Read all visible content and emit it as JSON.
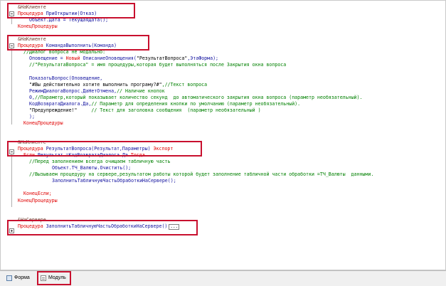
{
  "editor": {
    "lines": [
      {
        "indent": 2,
        "parts": [
          {
            "t": "&НаКлиенте",
            "c": "pp"
          }
        ]
      },
      {
        "indent": 2,
        "parts": [
          {
            "t": "Процедура ",
            "c": "kw"
          },
          {
            "t": "ПриОткрытии(Отказ)",
            "c": "id"
          }
        ]
      },
      {
        "indent": 6,
        "parts": [
          {
            "t": "Объект.Дата = ТекущаяДата();",
            "c": "id"
          }
        ]
      },
      {
        "indent": 2,
        "parts": [
          {
            "t": "КонецПроцедуры",
            "c": "kw"
          }
        ]
      },
      {
        "indent": 2,
        "parts": [
          {
            "t": "",
            "c": "str"
          }
        ]
      },
      {
        "indent": 2,
        "parts": [
          {
            "t": "&НаКлиенте",
            "c": "pp"
          }
        ]
      },
      {
        "indent": 2,
        "parts": [
          {
            "t": "Процедура ",
            "c": "kw"
          },
          {
            "t": "КомандаВыполнить(Команда)",
            "c": "id"
          }
        ]
      },
      {
        "indent": 4,
        "parts": [
          {
            "t": "//Диалог вопроса не модально:",
            "c": "cm"
          }
        ]
      },
      {
        "indent": 6,
        "parts": [
          {
            "t": "Оповещение = ",
            "c": "id"
          },
          {
            "t": "Новый ",
            "c": "kw"
          },
          {
            "t": "ОписаниеОповещения(",
            "c": "id"
          },
          {
            "t": "\"РезультатВопроса\"",
            "c": "str"
          },
          {
            "t": ",ЭтаФорма);",
            "c": "id"
          }
        ]
      },
      {
        "indent": 6,
        "parts": [
          {
            "t": "//\"РезультатаВопроса\" = имя процедуры,которая будет выполняться после Закрытия окна вопроса",
            "c": "cm"
          }
        ]
      },
      {
        "indent": 2,
        "parts": [
          {
            "t": "",
            "c": "str"
          }
        ]
      },
      {
        "indent": 6,
        "parts": [
          {
            "t": "ПоказатьВопрос(Оповещение,",
            "c": "id"
          }
        ]
      },
      {
        "indent": 6,
        "parts": [
          {
            "t": "\"#Вы действительно хотите выполнить програму?#\"",
            "c": "str"
          },
          {
            "t": ",//Текст вопроса",
            "c": "cm"
          }
        ]
      },
      {
        "indent": 6,
        "parts": [
          {
            "t": "РежимДиалогаВопрос.ДаНетОтмена,",
            "c": "id"
          },
          {
            "t": "// Наличие кнопок",
            "c": "cm"
          }
        ]
      },
      {
        "indent": 6,
        "parts": [
          {
            "t": "0,",
            "c": "id"
          },
          {
            "t": "//Параметр,который показывает количество секунд  до автоматического закрытия окна вопроса (параметр необязательный).",
            "c": "cm"
          }
        ]
      },
      {
        "indent": 6,
        "parts": [
          {
            "t": "КодВозвратаДиалога.Да,",
            "c": "id"
          },
          {
            "t": "// Параметр для определения кнопки по умолчанию (параметр необязательный).",
            "c": "cm"
          }
        ]
      },
      {
        "indent": 6,
        "parts": [
          {
            "t": "\"Предупреждение!\"",
            "c": "str"
          },
          {
            "t": "     ",
            "c": "str"
          },
          {
            "t": "// Текст для заголовка сообщения  (параметр необязательный )",
            "c": "cm"
          }
        ]
      },
      {
        "indent": 6,
        "parts": [
          {
            "t": ");",
            "c": "id"
          }
        ]
      },
      {
        "indent": 4,
        "parts": [
          {
            "t": "КонецПроцедуры",
            "c": "kw"
          }
        ]
      },
      {
        "indent": 2,
        "parts": [
          {
            "t": "",
            "c": "str"
          }
        ]
      },
      {
        "indent": 2,
        "parts": [
          {
            "t": "",
            "c": "str"
          }
        ]
      },
      {
        "indent": 2,
        "parts": [
          {
            "t": "&НаКлиенте",
            "c": "pp"
          }
        ]
      },
      {
        "indent": 2,
        "parts": [
          {
            "t": "Процедура ",
            "c": "kw"
          },
          {
            "t": "РезультатВопроса(Результат,Параметры) ",
            "c": "id"
          },
          {
            "t": "Экспорт",
            "c": "kw"
          }
        ]
      },
      {
        "indent": 4,
        "parts": [
          {
            "t": "Если ",
            "c": "kw"
          },
          {
            "t": "Результат =КодВозвратаДиалога.Да ",
            "c": "id"
          },
          {
            "t": "Тогда",
            "c": "kw"
          }
        ]
      },
      {
        "indent": 6,
        "parts": [
          {
            "t": "//Перед заполнением всегда очищаем табличную часть",
            "c": "cm"
          }
        ]
      },
      {
        "indent": 14,
        "parts": [
          {
            "t": "Объект.ТЧ_Валюты.Очистить();",
            "c": "id"
          }
        ]
      },
      {
        "indent": 6,
        "parts": [
          {
            "t": "//Вызываем процедуру на сервере,результатом работы которой будет заполнение табличной части обработки =ТЧ_Валюты  данными.",
            "c": "cm"
          }
        ]
      },
      {
        "indent": 14,
        "parts": [
          {
            "t": "ЗаполнитьТабличнуюЧастьОбработкиНаСервере();",
            "c": "id"
          }
        ]
      },
      {
        "indent": 2,
        "parts": [
          {
            "t": "",
            "c": "str"
          }
        ]
      },
      {
        "indent": 4,
        "parts": [
          {
            "t": "КонецЕсли;",
            "c": "kw"
          }
        ]
      },
      {
        "indent": 2,
        "parts": [
          {
            "t": "КонецПроцедуры",
            "c": "kw"
          }
        ]
      },
      {
        "indent": 2,
        "parts": [
          {
            "t": "",
            "c": "str"
          }
        ]
      },
      {
        "indent": 2,
        "parts": [
          {
            "t": "",
            "c": "str"
          }
        ]
      },
      {
        "indent": 2,
        "parts": [
          {
            "t": "&НаСервере",
            "c": "pp"
          }
        ]
      },
      {
        "indent": 2,
        "parts": [
          {
            "t": "Процедура ",
            "c": "kw"
          },
          {
            "t": "ЗаполнитьТабличнуюЧастьОбработкиНаСервере()",
            "c": "id"
          },
          {
            "t": "...",
            "c": "dots"
          }
        ]
      }
    ]
  },
  "bottom_tabs": [
    {
      "label": "Форма",
      "icon": "form-icon"
    },
    {
      "label": "Модуль",
      "icon": "module-icon"
    }
  ]
}
